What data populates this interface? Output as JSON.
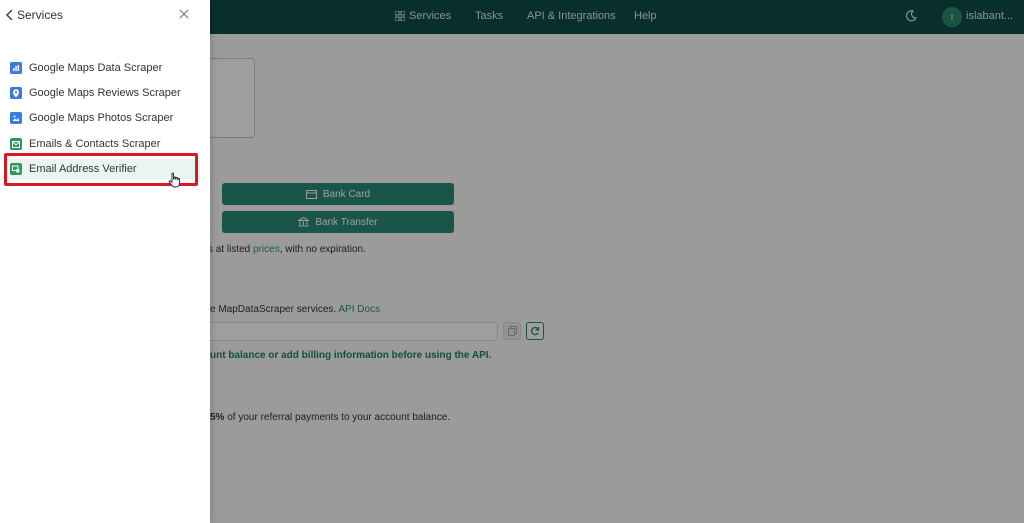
{
  "topbar": {
    "nav": [
      {
        "label": "Services",
        "icon": "grid-icon"
      },
      {
        "label": "Tasks"
      },
      {
        "label": "API & Integrations"
      },
      {
        "label": "Help"
      }
    ],
    "avatar_initial": "I",
    "username": "islabant..."
  },
  "main": {
    "bank_card_label": "Bank Card",
    "bank_transfer_label": "Bank Transfer",
    "credits_prefix": "s at listed ",
    "prices_link": "prices",
    "credits_suffix": ", with no expiration.",
    "api_prefix": "e MapDataScraper services. ",
    "api_docs_link": "API Docs",
    "api_warning": "unt balance or add billing information before using the API.",
    "referral_percent": "5%",
    "referral_text": " of your referral payments to your account balance."
  },
  "drawer": {
    "title": "Services",
    "items": [
      {
        "label": "Google Maps Data Scraper",
        "icon": "map-data-icon",
        "color": "#3b7be0"
      },
      {
        "label": "Google Maps Reviews Scraper",
        "icon": "map-pin-icon",
        "color": "#3b7be0"
      },
      {
        "label": "Google Maps Photos Scraper",
        "icon": "photo-icon",
        "color": "#3b7be0"
      },
      {
        "label": "Emails & Contacts Scraper",
        "icon": "envelope-icon",
        "color": "#2e9a5a"
      },
      {
        "label": "Email Address Verifier",
        "icon": "verify-icon",
        "color": "#2e9a5a"
      }
    ]
  },
  "colors": {
    "topbar": "#0d4c48",
    "accent": "#2a8a78",
    "highlight": "#d71920"
  }
}
